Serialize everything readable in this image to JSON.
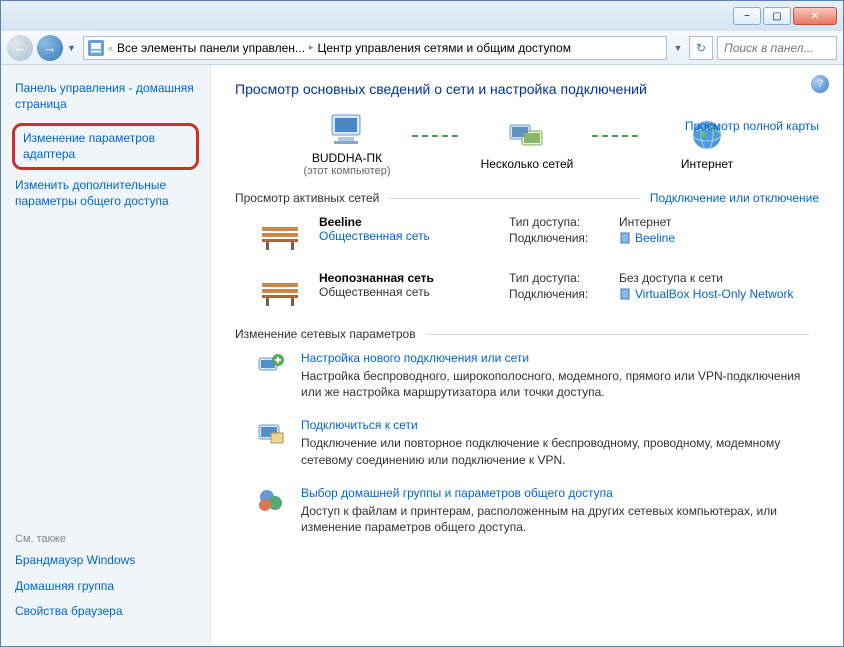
{
  "window": {
    "minimize": "−",
    "maximize": "▢",
    "close": "✕"
  },
  "nav": {
    "back": "←",
    "forward": "→",
    "dropdown": "▼",
    "breadcrumb_icon_sep": "«",
    "bc1": "Все элементы панели управлен...",
    "bc2": "Центр управления сетями и общим доступом",
    "sep": "▸",
    "refresh": "↻",
    "search_placeholder": "Поиск в панел..."
  },
  "sidebar": {
    "home": "Панель управления - домашняя страница",
    "link_adapter": "Изменение параметров адаптера",
    "link_sharing": "Изменить дополнительные параметры общего доступа",
    "see_also": "См. также",
    "firewall": "Брандмауэр Windows",
    "homegroup": "Домашняя группа",
    "browser": "Свойства браузера"
  },
  "content": {
    "help": "?",
    "title": "Просмотр основных сведений о сети и настройка подключений",
    "map_link": "Просмотр полной карты",
    "map": {
      "pc": "BUDDHA-ПК",
      "pc_sub": "(этот компьютер)",
      "multi": "Несколько сетей",
      "internet": "Интернет"
    },
    "active_label": "Просмотр активных сетей",
    "active_link": "Подключение или отключение",
    "net1": {
      "name": "Beeline",
      "type": "Общественная сеть",
      "access_label": "Тип доступа:",
      "access_val": "Интернет",
      "conn_label": "Подключения:",
      "conn_val": "Beeline"
    },
    "net2": {
      "name": "Неопознанная сеть",
      "type": "Общественная сеть",
      "access_label": "Тип доступа:",
      "access_val": "Без доступа к сети",
      "conn_label": "Подключения:",
      "conn_val": "VirtualBox Host-Only Network"
    },
    "change_label": "Изменение сетевых параметров",
    "set1": {
      "title": "Настройка нового подключения или сети",
      "desc": "Настройка беспроводного, широкополосного, модемного, прямого или VPN-подключения или же настройка маршрутизатора или точки доступа."
    },
    "set2": {
      "title": "Подключиться к сети",
      "desc": "Подключение или повторное подключение к беспроводному, проводному, модемному сетевому соединению или подключение к VPN."
    },
    "set3": {
      "title": "Выбор домашней группы и параметров общего доступа",
      "desc": "Доступ к файлам и принтерам, расположенным на других сетевых компьютерах, или изменение параметров общего доступа."
    }
  }
}
